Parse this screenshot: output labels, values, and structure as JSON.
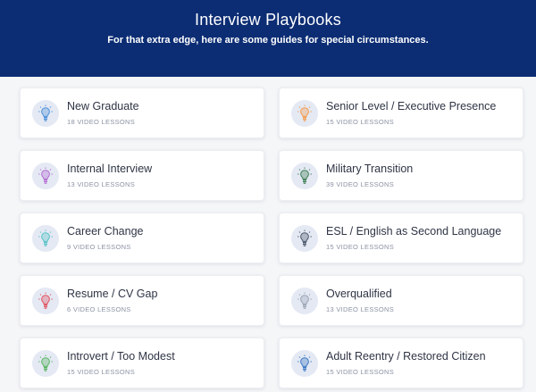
{
  "header": {
    "title": "Interview Playbooks",
    "subtitle": "For that extra edge, here are some guides for special circumstances."
  },
  "cards": [
    {
      "title": "New Graduate",
      "meta": "18 VIDEO LESSONS",
      "icon": "lightbulb-icon",
      "color": "#4a8fd8"
    },
    {
      "title": "Senior Level / Executive Presence",
      "meta": "15 VIDEO LESSONS",
      "icon": "lightbulb-icon",
      "color": "#f39a4b"
    },
    {
      "title": "Internal Interview",
      "meta": "13 VIDEO LESSONS",
      "icon": "lightbulb-icon",
      "color": "#b36ad0"
    },
    {
      "title": "Military Transition",
      "meta": "39 VIDEO LESSONS",
      "icon": "lightbulb-icon",
      "color": "#3d7d52"
    },
    {
      "title": "Career Change",
      "meta": "9 VIDEO LESSONS",
      "icon": "lightbulb-icon",
      "color": "#56c2c6"
    },
    {
      "title": "ESL / English as Second Language",
      "meta": "15 VIDEO LESSONS",
      "icon": "lightbulb-icon",
      "color": "#4a5568"
    },
    {
      "title": "Resume / CV Gap",
      "meta": "6 VIDEO LESSONS",
      "icon": "lightbulb-icon",
      "color": "#e0525e"
    },
    {
      "title": "Overqualified",
      "meta": "13 VIDEO LESSONS",
      "icon": "lightbulb-icon",
      "color": "#9aa3b2"
    },
    {
      "title": "Introvert / Too Modest",
      "meta": "15 VIDEO LESSONS",
      "icon": "lightbulb-icon",
      "color": "#57b35e"
    },
    {
      "title": "Adult Reentry / Restored Citizen",
      "meta": "15 VIDEO LESSONS",
      "icon": "lightbulb-icon",
      "color": "#3a78c2"
    }
  ]
}
